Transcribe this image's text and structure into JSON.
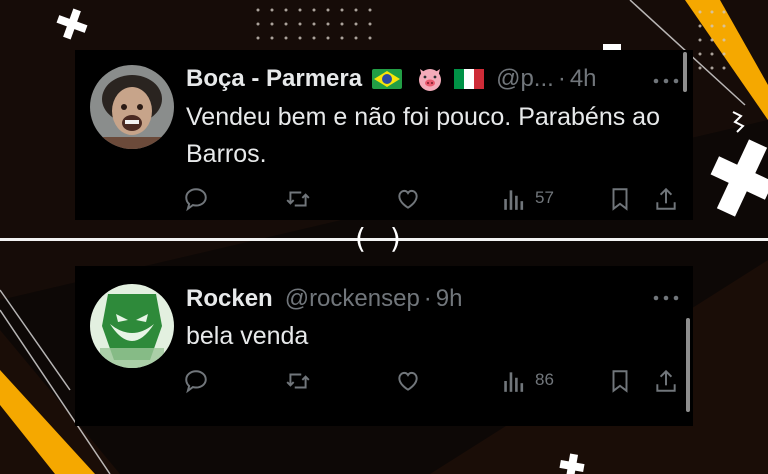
{
  "tweets": [
    {
      "name": "Boça - Parmera",
      "emojis": [
        "brazil-flag",
        "pig-face",
        "italy-flag"
      ],
      "handle": "@p...",
      "separator": "·",
      "time": "4h",
      "text": "Vendeu bem e não foi pouco. Parabéns ao Barros.",
      "views": "57"
    },
    {
      "name": "Rocken",
      "handle": "@rockensep",
      "separator": "·",
      "time": "9h",
      "text": "bela venda",
      "views": "86"
    }
  ],
  "overlay": {
    "parens": "()"
  },
  "icons": [
    "reply-icon",
    "retweet-icon",
    "like-icon",
    "views-icon",
    "bookmark-icon",
    "share-icon",
    "more-icon"
  ],
  "colors": {
    "text": "#e7e9ea",
    "muted": "#71767b",
    "accent": "#f5a800",
    "card": "#000000"
  }
}
